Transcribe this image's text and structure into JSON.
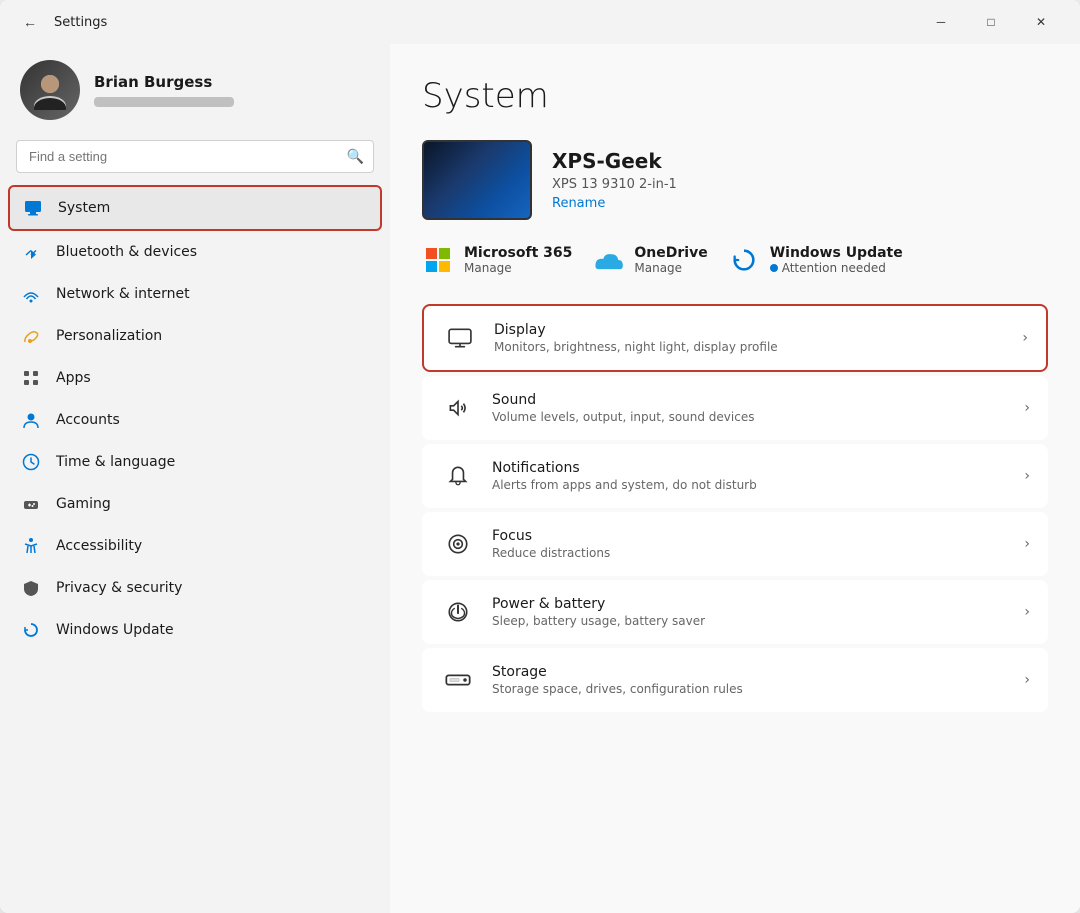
{
  "window": {
    "title": "Settings",
    "back_label": "←",
    "minimize": "─",
    "maximize": "□",
    "close": "✕"
  },
  "user": {
    "name": "Brian Burgess",
    "avatar_text": "👤"
  },
  "search": {
    "placeholder": "Find a setting"
  },
  "nav": {
    "items": [
      {
        "id": "system",
        "label": "System",
        "icon": "monitor",
        "active": true
      },
      {
        "id": "bluetooth",
        "label": "Bluetooth & devices",
        "icon": "bluetooth"
      },
      {
        "id": "network",
        "label": "Network & internet",
        "icon": "network"
      },
      {
        "id": "personalization",
        "label": "Personalization",
        "icon": "paint"
      },
      {
        "id": "apps",
        "label": "Apps",
        "icon": "apps"
      },
      {
        "id": "accounts",
        "label": "Accounts",
        "icon": "accounts"
      },
      {
        "id": "time",
        "label": "Time & language",
        "icon": "time"
      },
      {
        "id": "gaming",
        "label": "Gaming",
        "icon": "gaming"
      },
      {
        "id": "accessibility",
        "label": "Accessibility",
        "icon": "accessibility"
      },
      {
        "id": "privacy",
        "label": "Privacy & security",
        "icon": "privacy"
      },
      {
        "id": "update",
        "label": "Windows Update",
        "icon": "update"
      }
    ]
  },
  "main": {
    "title": "System",
    "device": {
      "name": "XPS-Geek",
      "model": "XPS 13 9310 2-in-1",
      "rename_label": "Rename"
    },
    "services": [
      {
        "id": "ms365",
        "name": "Microsoft 365",
        "action": "Manage"
      },
      {
        "id": "onedrive",
        "name": "OneDrive",
        "action": "Manage"
      },
      {
        "id": "winupdate",
        "name": "Windows Update",
        "action": "Attention needed"
      }
    ],
    "settings": [
      {
        "id": "display",
        "title": "Display",
        "desc": "Monitors, brightness, night light, display profile",
        "highlighted": true
      },
      {
        "id": "sound",
        "title": "Sound",
        "desc": "Volume levels, output, input, sound devices"
      },
      {
        "id": "notifications",
        "title": "Notifications",
        "desc": "Alerts from apps and system, do not disturb"
      },
      {
        "id": "focus",
        "title": "Focus",
        "desc": "Reduce distractions"
      },
      {
        "id": "power",
        "title": "Power & battery",
        "desc": "Sleep, battery usage, battery saver"
      },
      {
        "id": "storage",
        "title": "Storage",
        "desc": "Storage space, drives, configuration rules"
      }
    ]
  }
}
